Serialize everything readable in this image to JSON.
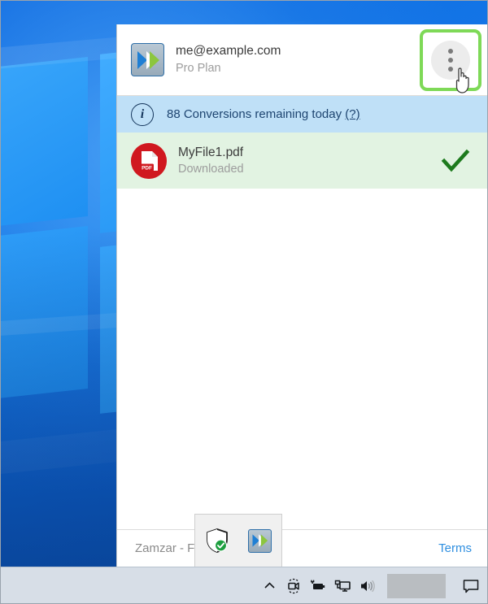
{
  "desktop": {
    "wallpaper_name": "windows-logo-wallpaper",
    "wallpaper_color": "#1478e8"
  },
  "app_panel": {
    "account": {
      "icon_name": "zamzar-app-icon",
      "email": "me@example.com",
      "plan": "Pro Plan",
      "menu_button": {
        "icon_name": "kebab-menu-icon",
        "dots": 3,
        "highlight_color": "#7ed957",
        "cursor_name": "hand-pointer-cursor"
      }
    },
    "info_bar": {
      "icon_name": "info-circle-icon",
      "icon_glyph": "i",
      "message": "88 Conversions remaining today",
      "help_label": "(?)",
      "background_color": "#bfe0f7"
    },
    "files": [
      {
        "icon_name": "pdf-file-icon",
        "icon_label": "PDF",
        "name": "MyFile1.pdf",
        "status": "Downloaded",
        "state_icon_name": "check-mark-icon",
        "row_background": "#e2f3e2",
        "check_color": "#1d7a1d"
      }
    ],
    "footer": {
      "title": "Zamzar - F",
      "terms_label": "Terms",
      "link_color": "#2f8fe0"
    }
  },
  "tray_flyout": {
    "items": [
      {
        "icon_name": "windows-defender-shield-icon",
        "label": "Windows Defender"
      },
      {
        "icon_name": "zamzar-tray-icon",
        "label": "Zamzar"
      }
    ]
  },
  "taskbar": {
    "background_color": "#d7dee7",
    "icons": [
      {
        "icon_name": "show-hidden-icons-chevron-up-icon"
      },
      {
        "icon_name": "camera-icon"
      },
      {
        "icon_name": "battery-power-icon"
      },
      {
        "icon_name": "network-monitor-icon"
      },
      {
        "icon_name": "volume-speaker-icon"
      }
    ],
    "clock_redacted": true,
    "notification_icon_name": "notification-bubble-icon"
  }
}
